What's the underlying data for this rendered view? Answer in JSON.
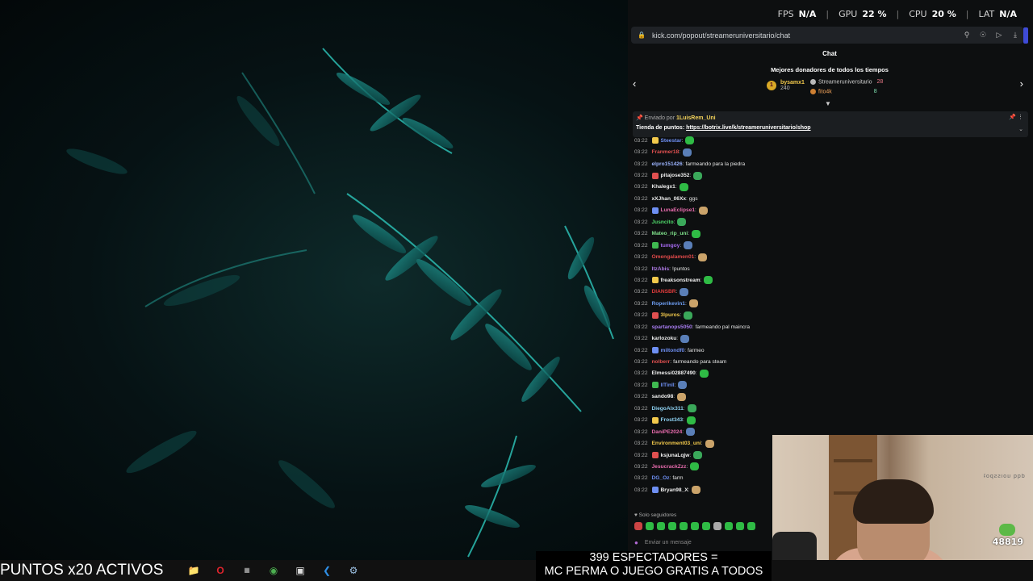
{
  "overlay": {
    "fps_label": "FPS",
    "fps_value": "N/A",
    "gpu_label": "GPU",
    "gpu_value": "22 %",
    "cpu_label": "CPU",
    "cpu_value": "20 %",
    "lat_label": "LAT",
    "lat_value": "N/A"
  },
  "browser": {
    "url": "kick.com/popout/streameruniversitario/chat",
    "lock_icon": "lock-icon",
    "toolbar_icons": [
      "search-icon",
      "shield-icon",
      "send-icon",
      "download-icon"
    ]
  },
  "chat": {
    "header": "Chat",
    "donors_title": "Mejores donadores de todos los tiempos",
    "donors": [
      {
        "rank": "1",
        "name": "bysamx1",
        "amount": "240"
      },
      {
        "name": "Streameruniversitario",
        "amount": "28"
      },
      {
        "name": "fito4k",
        "amount": "8"
      }
    ],
    "pinned": {
      "sent_by": "Enviado por",
      "user": "1LuisRem_Uni",
      "text_label": "Tienda de puntos:",
      "link": "https://botrix.live/k/streameruniversitario/shop"
    },
    "messages": [
      {
        "time": "03:22",
        "user": "Steestar",
        "text": "",
        "color": "#6e8ff2"
      },
      {
        "time": "03:22",
        "user": "Franmer18",
        "text": "",
        "color": "#e05050"
      },
      {
        "time": "03:22",
        "user": "elpro151426",
        "text": "farmeando para la piedra",
        "color": "#9cb4ff"
      },
      {
        "time": "03:22",
        "user": "pitajose352",
        "text": "",
        "color": "#eeeeee"
      },
      {
        "time": "03:22",
        "user": "Khalegx1",
        "text": "",
        "color": "#eeeeee"
      },
      {
        "time": "03:22",
        "user": "xXJhan_06Xx",
        "text": "ggs",
        "color": "#eeeeee"
      },
      {
        "time": "03:22",
        "user": "LunaEclipse1",
        "text": "",
        "color": "#e86cae"
      },
      {
        "time": "03:22",
        "user": "Jusncito",
        "text": "",
        "color": "#4fd96a"
      },
      {
        "time": "03:22",
        "user": "Mateo_rip_uni",
        "text": "",
        "color": "#7fe08a"
      },
      {
        "time": "03:22",
        "user": "tumgoy",
        "text": "",
        "color": "#a569f0"
      },
      {
        "time": "03:22",
        "user": "Omengalamen01",
        "text": "",
        "color": "#e04a4a"
      },
      {
        "time": "03:22",
        "user": "ItzAbis",
        "text": "!puntos",
        "color": "#b07ce8"
      },
      {
        "time": "03:22",
        "user": "freaksonstream",
        "text": "",
        "color": "#eeeeee"
      },
      {
        "time": "03:22",
        "user": "DIANSBR",
        "text": "",
        "color": "#e03c3c"
      },
      {
        "time": "03:22",
        "user": "Roperikevin1",
        "text": "",
        "color": "#6e9ef2"
      },
      {
        "time": "03:22",
        "user": "3lpuros",
        "text": "",
        "color": "#f2c94c"
      },
      {
        "time": "03:22",
        "user": "spartanops5050",
        "text": "farmeando pal maincra",
        "color": "#a77cf0"
      },
      {
        "time": "03:22",
        "user": "karlozoku",
        "text": "",
        "color": "#eeeeee"
      },
      {
        "time": "03:22",
        "user": "miltondf0",
        "text": "farmeo",
        "color": "#6e8ff2"
      },
      {
        "time": "03:22",
        "user": "nolberr",
        "text": "farmeando para steam",
        "color": "#e05050"
      },
      {
        "time": "03:22",
        "user": "Elmessi02887490",
        "text": "",
        "color": "#eeeeee"
      },
      {
        "time": "03:22",
        "user": "llTinll",
        "text": "",
        "color": "#6e8ff2"
      },
      {
        "time": "03:22",
        "user": "sando98",
        "text": "",
        "color": "#eeeeee"
      },
      {
        "time": "03:22",
        "user": "DiegoAlx311",
        "text": "",
        "color": "#8fd3f4"
      },
      {
        "time": "03:22",
        "user": "Frost343",
        "text": "",
        "color": "#8fd3f4"
      },
      {
        "time": "03:22",
        "user": "DaniPE2024",
        "text": "",
        "color": "#e86cae"
      },
      {
        "time": "03:22",
        "user": "Environment03_uni",
        "text": "",
        "color": "#f2c94c"
      },
      {
        "time": "03:22",
        "user": "ksjunaLqjw",
        "text": "",
        "color": "#eeeeee"
      },
      {
        "time": "03:22",
        "user": "JesucrackZzz",
        "text": "",
        "color": "#e86cae"
      },
      {
        "time": "03:22",
        "user": "DG_Oz",
        "text": "farm",
        "color": "#6e8ff2"
      },
      {
        "time": "03:22",
        "user": "Bryan98_X",
        "text": "",
        "color": "#eeeeee"
      }
    ],
    "followers_only": "Solo seguidores",
    "input_placeholder": "Enviar un mensaje"
  },
  "webcam": {
    "count": "48819"
  },
  "bottom": {
    "puntos": "PUNTOS x20 ACTIVOS",
    "banner_line1": "399 ESPECTADORES =",
    "banner_line2": "MC PERMA O JUEGO GRATIS A TODOS"
  },
  "taskbar": {
    "icons": [
      "file-explorer-icon",
      "opera-icon",
      "app-icon",
      "chrome-icon",
      "window-icon",
      "vscode-icon",
      "steam-icon"
    ]
  }
}
